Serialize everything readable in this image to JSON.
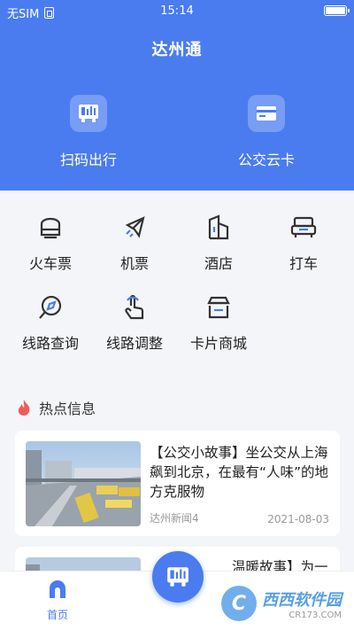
{
  "status": {
    "carrier": "无SIM",
    "time": "15:14"
  },
  "app_title": "达州通",
  "quick_actions": [
    {
      "label": "扫码出行",
      "icon": "bus-qr-icon"
    },
    {
      "label": "公交云卡",
      "icon": "card-icon"
    }
  ],
  "services": [
    {
      "label": "火车票",
      "icon": "train-icon"
    },
    {
      "label": "机票",
      "icon": "plane-icon"
    },
    {
      "label": "酒店",
      "icon": "hotel-icon"
    },
    {
      "label": "打车",
      "icon": "taxi-icon"
    },
    {
      "label": "线路查询",
      "icon": "route-search-icon"
    },
    {
      "label": "线路调整",
      "icon": "route-adjust-icon"
    },
    {
      "label": "卡片商城",
      "icon": "card-shop-icon"
    }
  ],
  "hot_info": {
    "title": "热点信息",
    "articles": [
      {
        "title": "【公交小故事】坐公交从上海飙到北京，在最有“人味”的地方克服物",
        "source": "达州新闻4",
        "date": "2021-08-03"
      },
      {
        "title": "温暖故事】为一"
      }
    ]
  },
  "tabbar": {
    "home_label": "首页"
  },
  "watermark": {
    "name": "西西",
    "site": "软件园",
    "url": "CR173.COM"
  },
  "colors": {
    "primary": "#4a7cf0",
    "background": "#f4f5f8"
  }
}
